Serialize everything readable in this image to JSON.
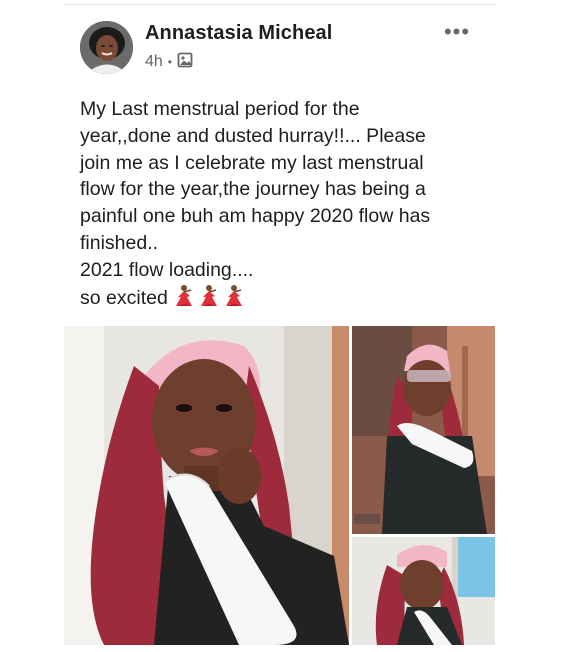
{
  "post": {
    "author": "Annastasia Micheal",
    "time": "4h",
    "privacy_icon": "photo-icon",
    "more_icon": "more-options-icon",
    "more_label": "•••",
    "separator": "•",
    "lines": [
      "My Last menstrual period for the",
      "year,,done and dusted hurray!!... Please",
      "join me as I celebrate my last menstrual",
      "flow for the year,the journey has being a",
      "painful one buh am happy 2020 flow has",
      "finished..",
      "2021 flow loading....",
      "so excited"
    ],
    "emoji": [
      "dancer-emoji",
      "dancer-emoji",
      "dancer-emoji"
    ]
  },
  "photos": [
    {
      "name": "photo-main",
      "icon": "photo"
    },
    {
      "name": "photo-top-right",
      "icon": "photo"
    },
    {
      "name": "photo-bottom-right",
      "icon": "photo"
    }
  ],
  "colors": {
    "text": "#1c1e21",
    "secondary": "#65676b",
    "hair": "#9e2b3c",
    "headscarf": "#f2b6c6",
    "pad": "#f7f7f7"
  }
}
